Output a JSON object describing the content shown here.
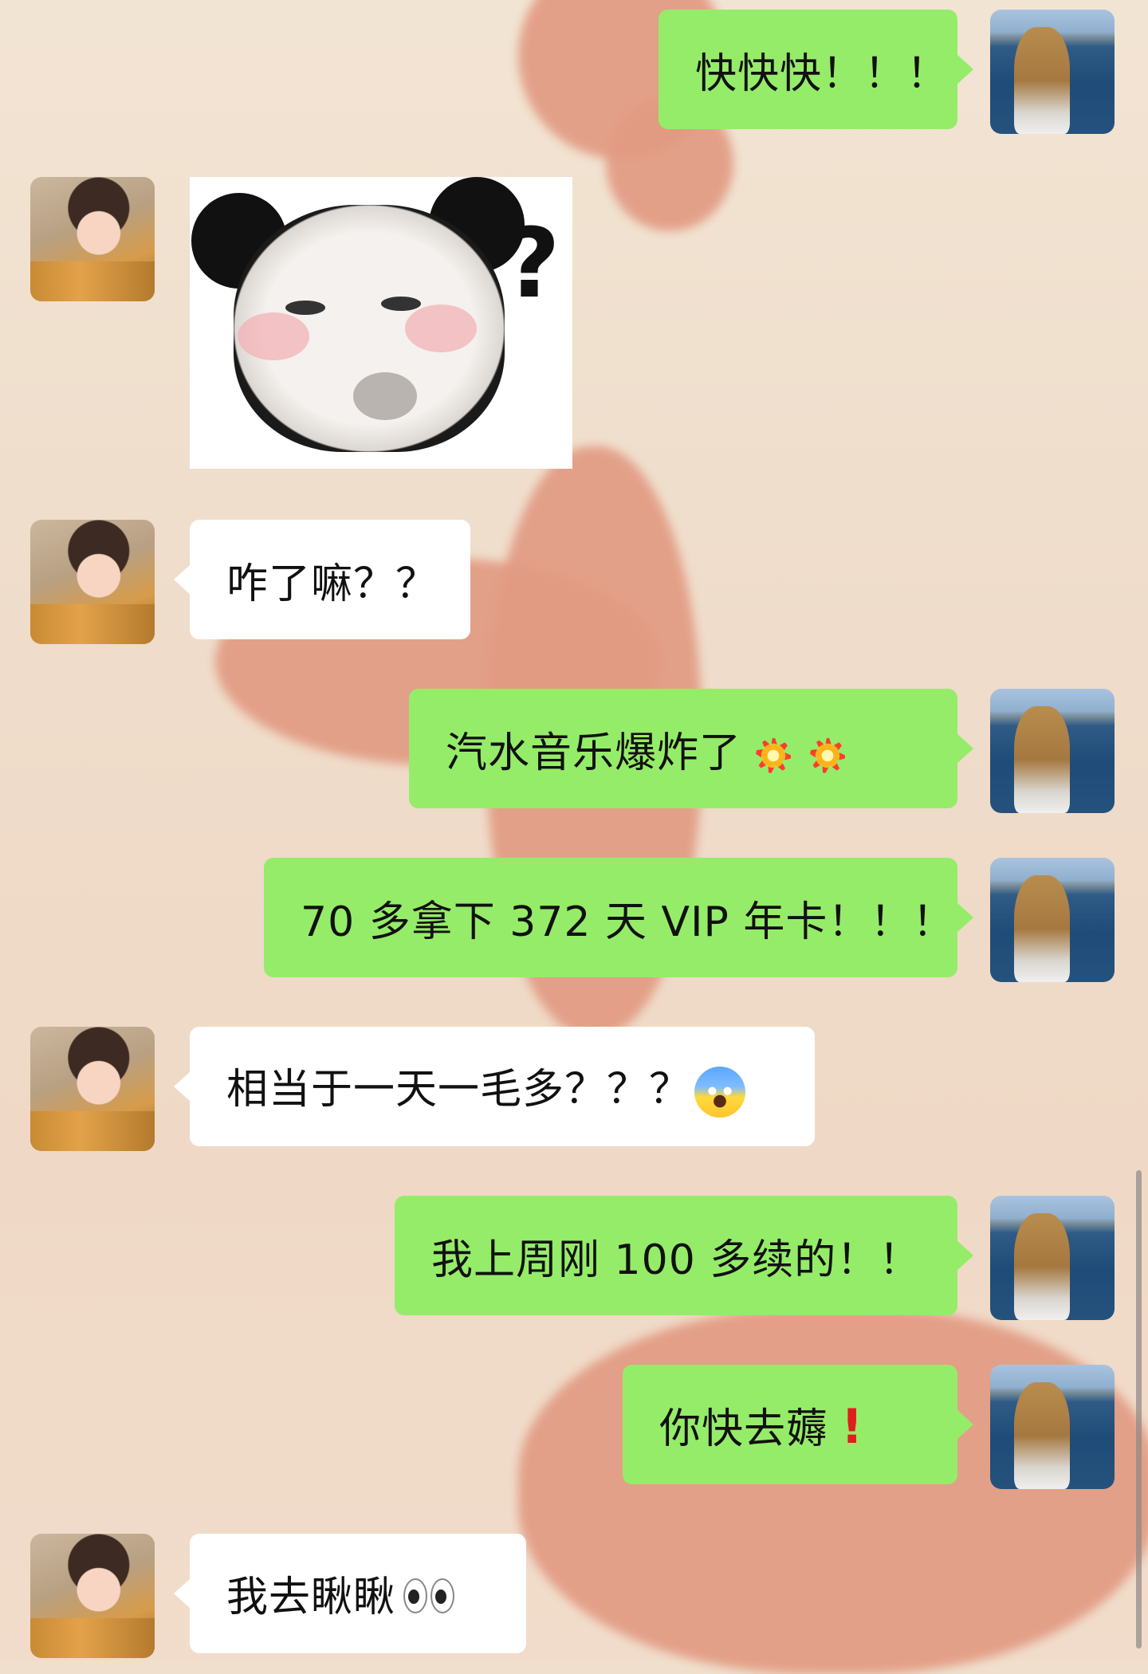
{
  "chat": {
    "messages": [
      {
        "side": "right",
        "type": "text",
        "text": "快快快！！！"
      },
      {
        "side": "left",
        "type": "sticker",
        "sticker": "panda-question-meme"
      },
      {
        "side": "left",
        "type": "text",
        "text": "咋了嘛？？"
      },
      {
        "side": "right",
        "type": "text",
        "text": "汽水音乐爆炸了",
        "emoji": [
          "collision",
          "collision"
        ]
      },
      {
        "side": "right",
        "type": "text",
        "text": "70 多拿下 372 天 VIP 年卡！！！"
      },
      {
        "side": "left",
        "type": "text",
        "text": "相当于一天一毛多？？？",
        "emoji": [
          "face-screaming-in-fear"
        ]
      },
      {
        "side": "right",
        "type": "text",
        "text": "我上周刚 100 多续的！！"
      },
      {
        "side": "right",
        "type": "text",
        "text": "你快去薅",
        "emoji": [
          "red-exclamation-mark"
        ]
      },
      {
        "side": "left",
        "type": "text",
        "text": "我去瞅瞅",
        "emoji": [
          "eyes"
        ]
      }
    ]
  },
  "colors": {
    "outgoing_bubble": "#95ec69",
    "incoming_bubble": "#ffffff",
    "background": "#f0dfcd",
    "background_pattern": "#e29b83"
  }
}
